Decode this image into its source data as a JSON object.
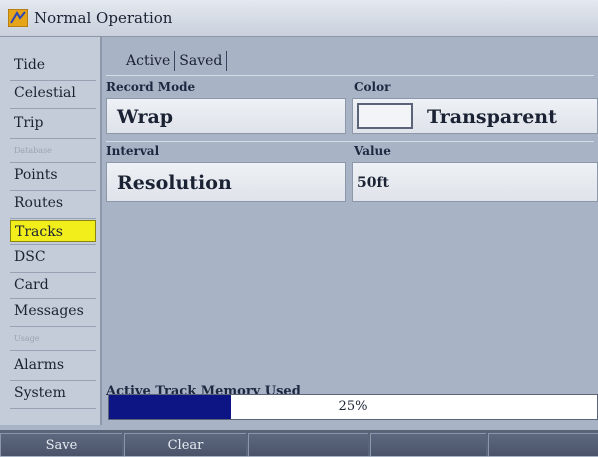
{
  "window": {
    "title": "Normal Operation"
  },
  "sidebar": {
    "items": [
      {
        "label": "Tide",
        "dim": false
      },
      {
        "label": "Celestial",
        "dim": false
      },
      {
        "label": "Trip",
        "dim": false
      },
      {
        "label": "Database",
        "dim": true
      },
      {
        "label": "Points",
        "dim": false
      },
      {
        "label": "Routes",
        "dim": false
      },
      {
        "label": "Tracks",
        "dim": false,
        "selected": true
      },
      {
        "label": "DSC",
        "dim": false
      },
      {
        "label": "Card",
        "dim": false
      },
      {
        "label": "Messages",
        "dim": false
      },
      {
        "label": "Usage",
        "dim": true
      },
      {
        "label": "Alarms",
        "dim": false
      },
      {
        "label": "System",
        "dim": false
      }
    ]
  },
  "tabs": [
    {
      "label": "Active",
      "selected": true
    },
    {
      "label": "Saved",
      "selected": false
    }
  ],
  "record_mode": {
    "label": "Record Mode",
    "value": "Wrap"
  },
  "color": {
    "label": "Color",
    "value": "Transparent",
    "swatch": "#f2f4f7"
  },
  "interval": {
    "label": "Interval",
    "value": "Resolution"
  },
  "value_field": {
    "label": "Value",
    "value": "50ft"
  },
  "memory": {
    "label": "Active Track Memory Used",
    "percent_text": "25%",
    "fraction": 0.25
  },
  "footer": {
    "buttons": [
      {
        "label": "Save"
      },
      {
        "label": "Clear"
      },
      {
        "label": ""
      },
      {
        "label": ""
      },
      {
        "label": ""
      }
    ]
  },
  "colors": {
    "accent_selected": "#f2ee1c",
    "progress_fill": "#0d1585",
    "background": "#a9b3c6"
  }
}
